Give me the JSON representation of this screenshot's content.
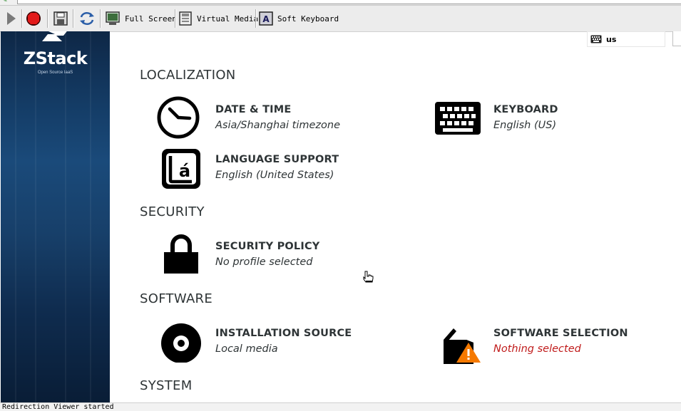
{
  "viewer": {
    "toolbar": {
      "play_icon": "play-icon",
      "stop_icon": "stop-icon",
      "save_icon": "floppy-icon",
      "refresh_icon": "refresh-icon",
      "full_screen_label": "Full Screen",
      "virtual_media_label": "Virtual Media",
      "soft_keyboard_label": "Soft Keyboard"
    },
    "status_text": "Redirection Viewer started"
  },
  "branding": {
    "logo_text": "ZStack",
    "logo_subtitle": "Open Source IaaS"
  },
  "keyboard_indicator": {
    "layout": "us"
  },
  "sections": {
    "localization": "LOCALIZATION",
    "security": "SECURITY",
    "software": "SOFTWARE",
    "system": "SYSTEM"
  },
  "spokes": {
    "date_time": {
      "title": "DATE & TIME",
      "status": "Asia/Shanghai timezone"
    },
    "keyboard": {
      "title": "KEYBOARD",
      "status": "English (US)"
    },
    "language": {
      "title": "LANGUAGE SUPPORT",
      "status": "English (United States)"
    },
    "security_policy": {
      "title": "SECURITY POLICY",
      "status": "No profile selected"
    },
    "installation_source": {
      "title": "INSTALLATION SOURCE",
      "status": "Local media"
    },
    "software_selection": {
      "title": "SOFTWARE SELECTION",
      "status": "Nothing selected",
      "status_color": "#c01c1c"
    }
  },
  "colors": {
    "sidebar_top": "#0e2746",
    "sidebar_mid": "#1a4a7a",
    "text": "#2e3436",
    "warning": "#c01c1c",
    "warning_icon": "#f57900"
  }
}
